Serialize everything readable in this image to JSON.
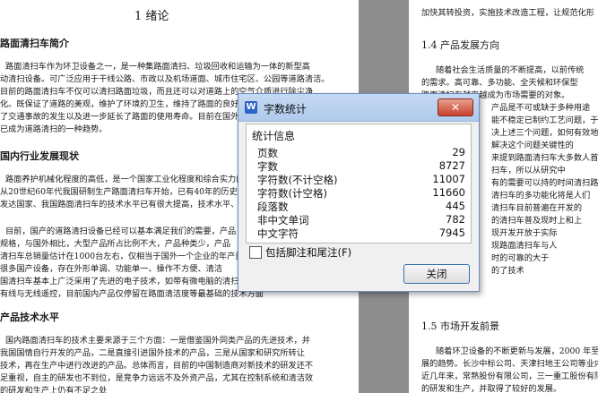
{
  "left_page": {
    "chapter_title": "1 绪论",
    "section_1": "路面清扫车简介",
    "para_1": [
      "路面清扫车作为环卫设备之一，是一种集路面清扫、垃圾回收和运输为一体的新型高",
      "动清扫设备。可广泛应用于干线公路、市政以及机场道面、城市住宅区、公园等道路清洁。",
      "目前的路面清扫车不仅可以清扫路面垃圾，而且还可以对道路上的空气介质进行除尘净",
      "化。既保证了道路的美观，维护了环境的卫生，维持了路面的良好工作状态，减少和预防",
      "了交通事故的发生以及进一步延长了路面的使用寿命。目前在国外发达国家，路面清扫车",
      "已成为道路清扫的一种趋势。"
    ],
    "section_2": "国内行业发展现状",
    "para_2": [
      "路面养护机械化程度的高低，是一个国家工业化程度和综合实力的重要体现之一。",
      "从20世纪60年代我国研制生产路面清扫车开始，已有40年的历史，近几年来，",
      "发达国家、我国路面清扫车的技术水平已有很大提高，技术水平、清洁效果",
      "",
      "目前，国产的道路清扫设备已经可以基本满足我们的需要，产品",
      "规格，与国外相比，大型产品所占比例不大，产品种类少，产品",
      "清扫车总销量估计在1000台左右，仅相当于国外一个企业的年产量",
      "很多国产设备，存在外形单调、功能单一、操作不方便、清洁",
      "国清扫车基本上广泛采用了先进的电子技术，如带有微电脑的清扫车，",
      "有线与无线遥控，目前国内产品仅停留在路面清洁度等最基础的技术方面"
    ],
    "section_3": "产品技术水平",
    "para_3": [
      "国内路面清扫车的技术主要来源于三个方面：一是借鉴国外同类产品的先进技术，并",
      "我国国情自行开发的产品，二是直接引进国外技术的产品，三是从国家和研究所转让",
      "技术，再在生产中进行改进的产品。总体而言，目前的中国制造商对新技术的研发还不",
      "足重视，自主的研发也不到位，是竞争力远远不及外资产品，尤其在控制系统和清洁效",
      "的研发和生产上仍有不足之处"
    ]
  },
  "right_page": {
    "lines_top": [
      "加快其转投资，实施技术改造工程，让规范化形"
    ],
    "section_14": "1.4 产品发展方向",
    "lines_14": [
      "随着社会生活质量的不断提高，以前传统",
      "的需求。高可靠、多功能、全天候和环保型",
      "路面清扫车越来越成为市场需要的对象。",
      "产品是不可或缺于多种用途",
      "能不稳定已制约工艺问题，于",
      "决上述三个问题，如何有效地",
      "解决这个问题关键性的",
      "来提到路面清扫车大多数人首",
      "扫车，所以从研究中",
      "有的需要可以持的时间清扫路",
      "清扫车的多功能化将是人们",
      "清扫车目前普遍在开发的",
      "的清扫车普及现时上和上",
      "现开发开放于实际",
      "现路面清扫车与人",
      "时的可靠的大于",
      "的了技术"
    ],
    "section_15": "1.5 市场开发前景",
    "lines_15": [
      "随着环卫设备的不断更新与发展，2000 年至",
      "展的趋势。长沙中标公司、天津扫地王公司等业内",
      "近几年来，常熟股份有限公司，三一重工股份有限",
      "的研发和生产，并取得了较好的发展。"
    ]
  },
  "dialog": {
    "title": "字数统计",
    "app_icon_letter": "W",
    "close_x_glyph": "✕",
    "stats_heading": "统计信息",
    "stats": [
      {
        "label": "页数",
        "value": "29"
      },
      {
        "label": "字数",
        "value": "8727"
      },
      {
        "label": "字符数(不计空格)",
        "value": "11007"
      },
      {
        "label": "字符数(计空格)",
        "value": "11660"
      },
      {
        "label": "段落数",
        "value": "445"
      },
      {
        "label": "非中文单词",
        "value": "782"
      },
      {
        "label": "中文字符",
        "value": "7945"
      }
    ],
    "footnote_label": "包括脚注和尾注(F)",
    "footnote_checked": false,
    "close_button_label": "关闭"
  },
  "colors": {
    "background": "#8a8a8a",
    "titlebar": "#b8d0ef",
    "close_button_red": "#c5412b",
    "app_icon_blue": "#2b63c6"
  }
}
